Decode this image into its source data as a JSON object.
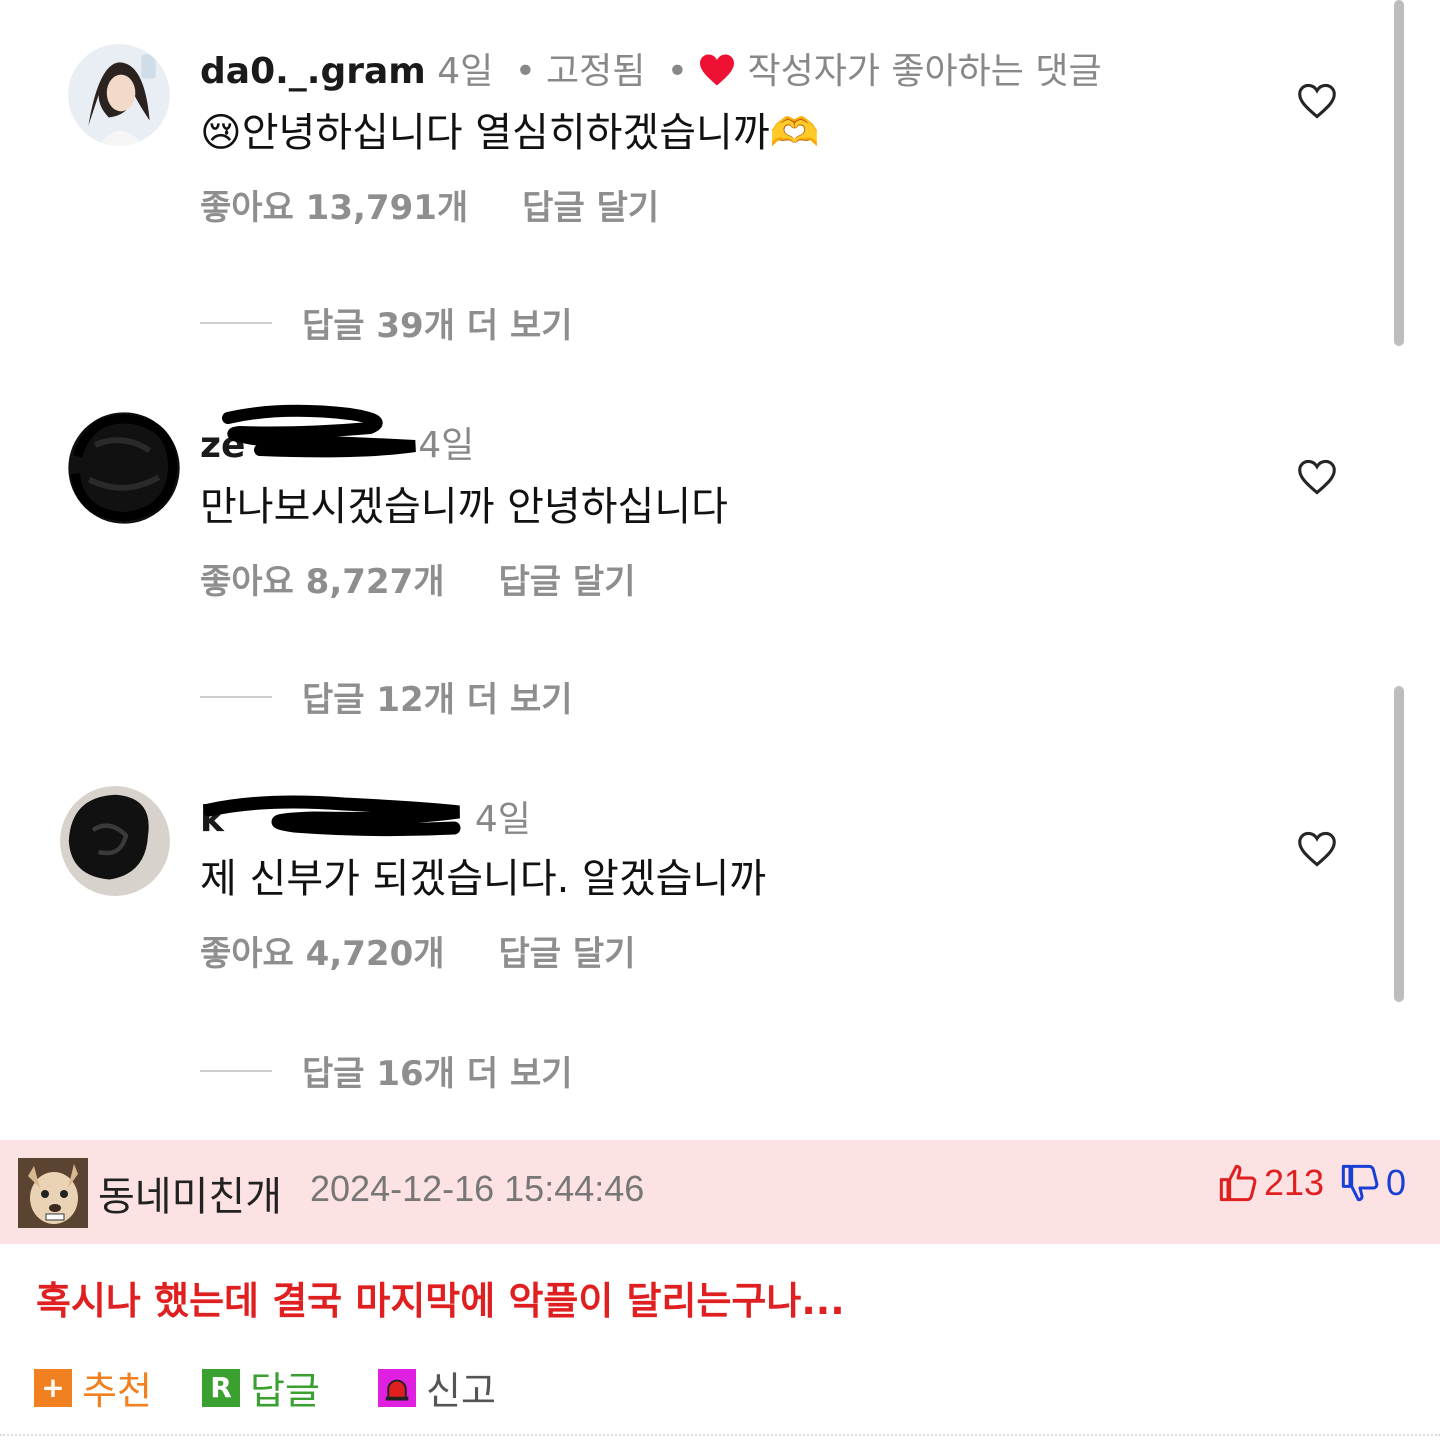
{
  "comments": [
    {
      "username": "da0._.gram",
      "time": "4일",
      "pinned": "고정됨",
      "liked_by_author": "작성자가 좋아하는 댓글",
      "emoji_lead": "😢",
      "text": "안녕하십니다 열심히하겠습니까",
      "emoji_trail": "🫶",
      "likes": "좋아요 13,791개",
      "reply": "답글 달기",
      "more_replies": "답글 39개 더 보기"
    },
    {
      "username": "ze",
      "time": "4일",
      "text": "만나보시겠습니까 안녕하십니다",
      "likes": "좋아요 8,727개",
      "reply": "답글 달기",
      "more_replies": "답글 12개 더 보기"
    },
    {
      "username": "k",
      "time": "4일",
      "text": "제 신부가 되겠습니다. 알겠습니까",
      "likes": "좋아요 4,720개",
      "reply": "답글 달기",
      "more_replies": "답글 16개 더 보기"
    }
  ],
  "post": {
    "nickname": "동네미친개",
    "datetime": "2024-12-16 15:44:46",
    "upvotes": "213",
    "downvotes": "0",
    "body": "혹시나 했는데 결국 마지막에 악플이 달리는구나...",
    "actions": {
      "recommend": "추천",
      "recommend_icon": "+",
      "reply": "답글",
      "reply_icon": "R",
      "report": "신고"
    }
  },
  "colors": {
    "post_header_bg": "#fde2e4",
    "upvote": "#e02020",
    "downvote": "#1a3fd6",
    "body_text": "#e02020",
    "recommend_box": "#f08020",
    "reply_box": "#3aa030",
    "report_box": "#e020e0"
  }
}
